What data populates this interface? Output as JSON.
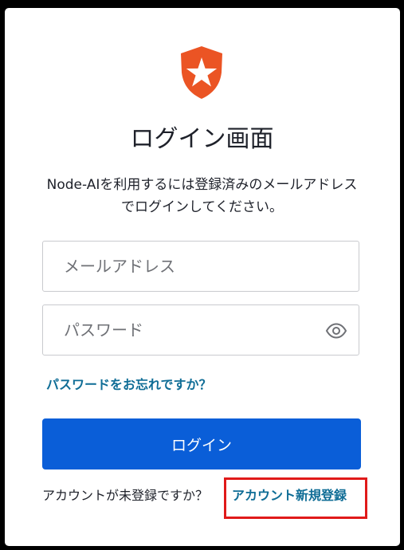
{
  "title": "ログイン画面",
  "description": {
    "line1": "Node-AIを利用するには登録済みのメールアドレス",
    "line2": "でログインしてください。"
  },
  "email_field": {
    "placeholder": "メールアドレス",
    "value": ""
  },
  "password_field": {
    "placeholder": "パスワード",
    "value": "",
    "toggle_icon": "eye-icon"
  },
  "forgot_link": "パスワードをお忘れですか？",
  "login_button": "ログイン",
  "signup": {
    "text": "アカウントが未登録ですか？",
    "link": "アカウント新規登録"
  },
  "colors": {
    "brand_logo": "#eb5424",
    "primary_button": "#0a5ed8",
    "link": "#0f6d96",
    "highlight_box": "#e01a1a"
  },
  "logo_icon": "star-shield-icon"
}
